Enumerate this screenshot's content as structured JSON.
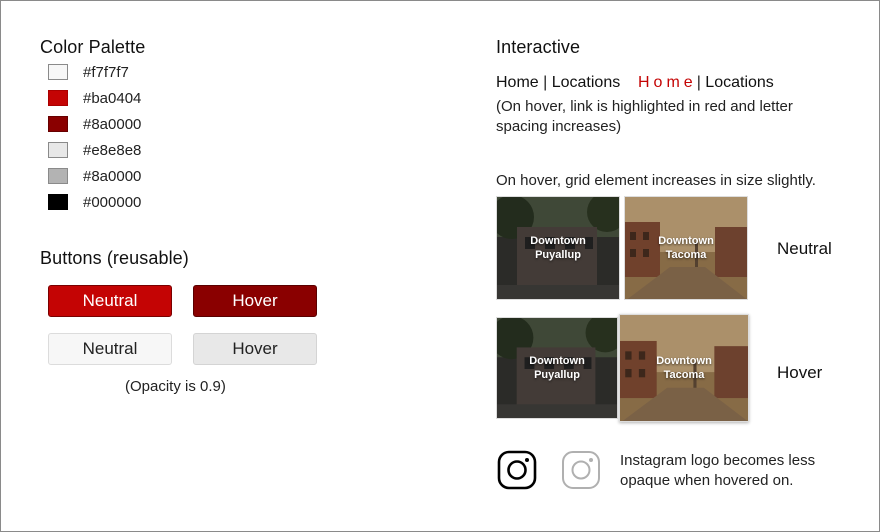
{
  "palette": {
    "title": "Color Palette",
    "swatches": [
      {
        "label": "#f7f7f7",
        "color": "#f7f7f7"
      },
      {
        "label": "#ba0404",
        "color": "#c40404"
      },
      {
        "label": "#8a0000",
        "color": "#8a0000"
      },
      {
        "label": "#e8e8e8",
        "color": "#e8e8e8"
      },
      {
        "label": "#8a0000",
        "color": "#b3b3b3"
      },
      {
        "label": "#000000",
        "color": "#000000"
      }
    ]
  },
  "buttons": {
    "title": "Buttons (reusable)",
    "red_neutral": "Neutral",
    "red_hover": "Hover",
    "light_neutral": "Neutral",
    "light_hover": "Hover",
    "note": "(Opacity is 0.9)"
  },
  "interactive": {
    "title": "Interactive",
    "nav_neutral": {
      "home": "Home",
      "separator": " | ",
      "locations": "Locations"
    },
    "nav_hover": {
      "home": "Home",
      "separator": "| ",
      "locations": "Locations"
    },
    "nav_note": "(On hover, link is highlighted in red and letter spacing increases)",
    "grid_note": "On hover, grid element increases in size slightly.",
    "tiles": {
      "puyallup_line1": "Downtown",
      "puyallup_line2": "Puyallup",
      "tacoma_line1": "Downtown",
      "tacoma_line2": "Tacoma"
    },
    "neutral_label": "Neutral",
    "hover_label": "Hover",
    "instagram_note": "Instagram logo becomes less opaque when hovered on."
  },
  "colors": {
    "accent_red": "#c40404",
    "dark_red": "#8a0000"
  },
  "icons": [
    "instagram-icon",
    "instagram-icon-faded"
  ]
}
